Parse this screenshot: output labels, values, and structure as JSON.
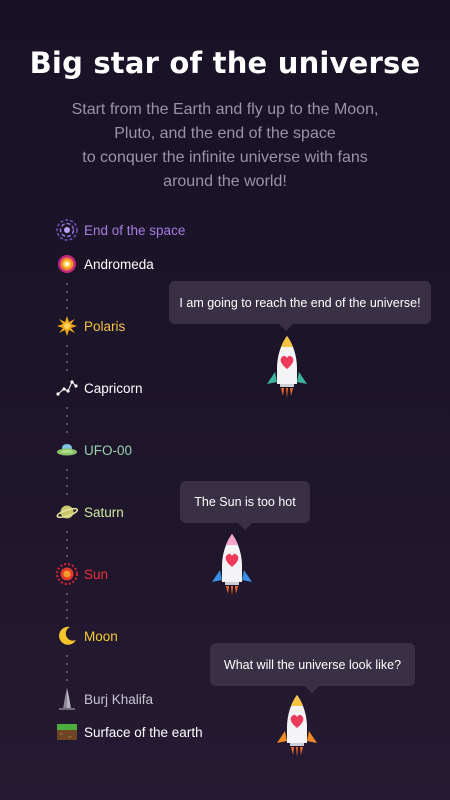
{
  "header": {
    "title": "Big star of the universe",
    "subtitle_lines": [
      "Start from the Earth and fly up to the Moon,",
      "Pluto, and the end of the space",
      "to conquer the infinite universe with fans",
      "around the world!"
    ]
  },
  "levels": [
    {
      "label": "End of the space",
      "color": "#a77ee0",
      "icon": "galaxy-icon"
    },
    {
      "label": "Andromeda",
      "color": "#ffffff",
      "icon": "andromeda-icon"
    },
    {
      "label": "Polaris",
      "color": "#f5c342",
      "icon": "polaris-star-icon"
    },
    {
      "label": "Capricorn",
      "color": "#ffffff",
      "icon": "constellation-icon"
    },
    {
      "label": "UFO-00",
      "color": "#9bd0b0",
      "icon": "ufo-icon"
    },
    {
      "label": "Saturn",
      "color": "#cfe8a0",
      "icon": "saturn-icon"
    },
    {
      "label": "Sun",
      "color": "#e8303a",
      "icon": "sun-icon"
    },
    {
      "label": "Moon",
      "color": "#f5cc2e",
      "icon": "moon-icon"
    },
    {
      "label": "Burj Khalifa",
      "color": "#c9c4d2",
      "icon": "tower-icon"
    },
    {
      "label": "Surface of the earth",
      "color": "#ffffff",
      "icon": "earth-surface-icon"
    }
  ],
  "bubbles": [
    "I am going to reach the end of the universe!",
    "The Sun is too hot",
    "What will the universe look like?"
  ],
  "colors": {
    "background": "#1c1428",
    "bubble": "#3a3045",
    "subtitle": "#9a93a6"
  }
}
